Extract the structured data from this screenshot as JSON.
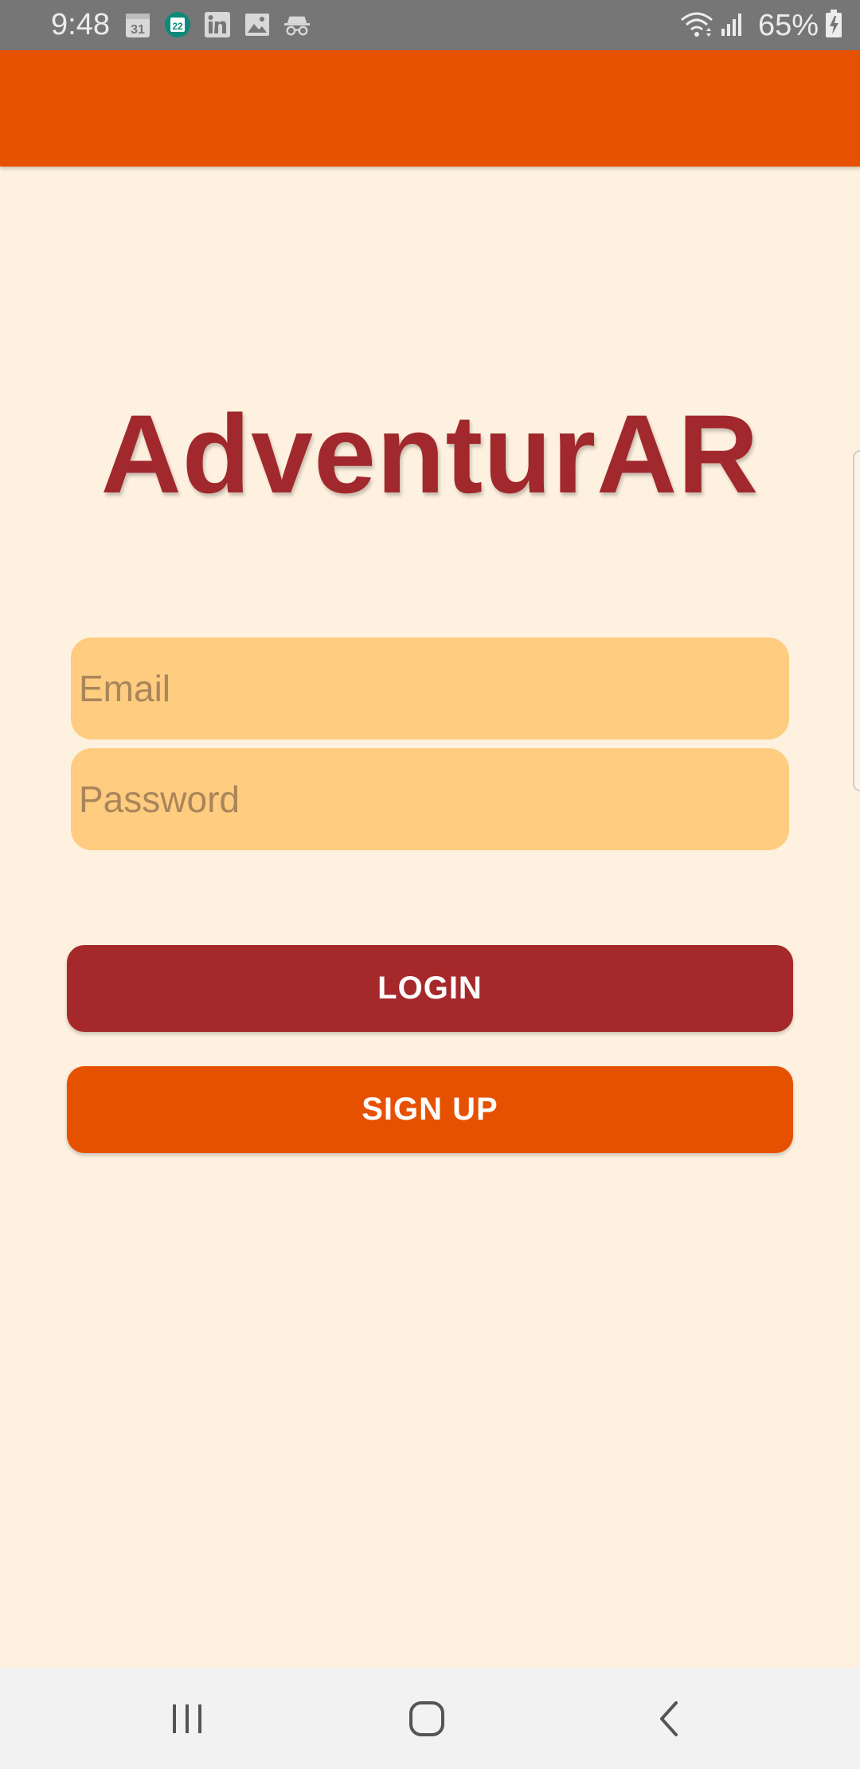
{
  "status_bar": {
    "time": "9:48",
    "calendar_day_1": "31",
    "calendar_day_2": "22",
    "battery_percent": "65%",
    "icons_left": [
      "calendar-icon",
      "calendar-badge-icon",
      "linkedin-icon",
      "image-icon",
      "incognito-icon"
    ],
    "icons_right": [
      "wifi-icon",
      "signal-icon",
      "battery-charging-icon"
    ]
  },
  "app": {
    "logo_text": "AdventurAR",
    "colors": {
      "app_bar": "#E65100",
      "background": "#FEF1DF",
      "logo": "#A1282C",
      "field": "#FFCC80",
      "login_button": "#A5292B",
      "signup_button": "#E65100"
    }
  },
  "form": {
    "email": {
      "placeholder": "Email",
      "value": ""
    },
    "password": {
      "placeholder": "Password",
      "value": ""
    },
    "login_label": "LOGIN",
    "signup_label": "SIGN UP"
  },
  "nav_bar": {
    "icons": [
      "recents-icon",
      "home-icon",
      "back-icon"
    ]
  }
}
